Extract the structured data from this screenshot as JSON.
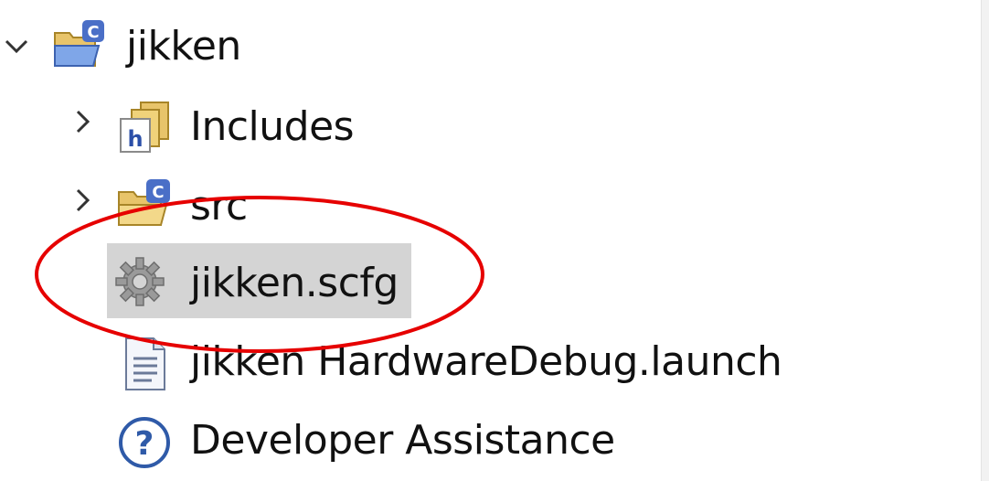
{
  "tree": {
    "project": {
      "label": "jikken",
      "expanded": true,
      "icon": "c-project-folder-icon"
    },
    "children": [
      {
        "label": "Includes",
        "expandable": true,
        "icon": "includes-icon"
      },
      {
        "label": "src",
        "expandable": true,
        "icon": "c-source-folder-icon"
      },
      {
        "label": "jikken.scfg",
        "expandable": false,
        "selected": true,
        "icon": "gear-icon"
      },
      {
        "label": "jikken HardwareDebug.launch",
        "expandable": false,
        "icon": "file-icon"
      },
      {
        "label": "Developer Assistance",
        "expandable": false,
        "icon": "help-icon"
      }
    ]
  },
  "colors": {
    "selection": "#d4d4d4",
    "annotation_ellipse": "#e60000",
    "folder_yellow": "#e8c46a",
    "c_badge_blue": "#4a6fc7"
  }
}
